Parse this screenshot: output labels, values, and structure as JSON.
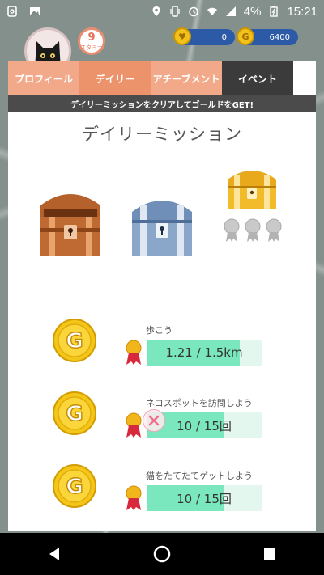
{
  "status_bar": {
    "battery": "4%",
    "time": "15:21"
  },
  "header": {
    "stamina_value": "9",
    "stamina_label": "スタミナ",
    "currency1_value": "0",
    "currency2_value": "6400"
  },
  "tabs": [
    {
      "label": "プロフィール"
    },
    {
      "label": "デイリー"
    },
    {
      "label": "アチーブメント"
    },
    {
      "label": "イベント"
    }
  ],
  "banner": "デイリーミッションをクリアしてゴールドをGET!",
  "title": "デイリーミッション",
  "missions": [
    {
      "label": "歩こう",
      "progress_text": "1.21 / 1.5km",
      "progress": 0.81
    },
    {
      "label": "ネコスポットを訪問しよう",
      "progress_text": "10 / 15回",
      "progress": 0.67
    },
    {
      "label": "猫をたてたてゲットしよう",
      "progress_text": "10 / 15回",
      "progress": 0.67
    }
  ],
  "icons": {
    "coin_letter": "G",
    "stamina": "stamina-icon",
    "chest_bronze": "bronze-chest-icon",
    "chest_silver": "silver-chest-icon",
    "chest_gold": "gold-chest-icon",
    "medal": "medal-icon",
    "close": "close-icon"
  },
  "colors": {
    "tab_active": "#ec936c",
    "tab_inactive": "#f1a98a",
    "tab_dark": "#3b3b3b",
    "progress_fill": "#7ae7bf",
    "progress_bg": "#e4f7ef",
    "currency_bg": "#2d5aa6"
  }
}
